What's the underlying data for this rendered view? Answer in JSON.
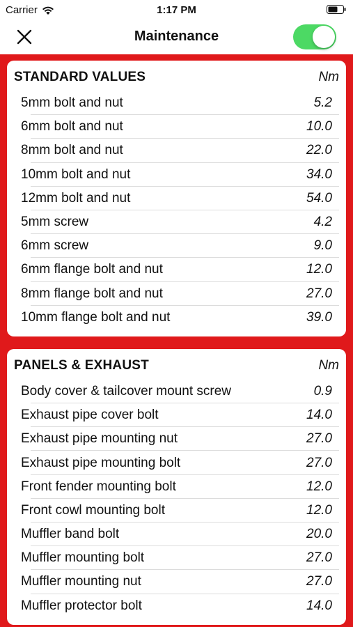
{
  "status_bar": {
    "carrier": "Carrier",
    "time": "1:17 PM"
  },
  "nav": {
    "title": "Maintenance",
    "toggle_on": true
  },
  "colors": {
    "background": "#e0191b",
    "toggle": "#4cd964"
  },
  "sections": [
    {
      "title": "STANDARD VALUES",
      "unit": "Nm",
      "rows": [
        {
          "label": "5mm bolt and nut",
          "value": "5.2"
        },
        {
          "label": "6mm bolt and nut",
          "value": "10.0"
        },
        {
          "label": "8mm bolt and nut",
          "value": "22.0"
        },
        {
          "label": "10mm bolt and nut",
          "value": "34.0"
        },
        {
          "label": "12mm bolt and nut",
          "value": "54.0"
        },
        {
          "label": "5mm screw",
          "value": "4.2"
        },
        {
          "label": "6mm screw",
          "value": "9.0"
        },
        {
          "label": "6mm flange bolt and nut",
          "value": "12.0"
        },
        {
          "label": "8mm flange bolt and nut",
          "value": "27.0"
        },
        {
          "label": "10mm flange bolt and nut",
          "value": "39.0"
        }
      ]
    },
    {
      "title": "PANELS & EXHAUST",
      "unit": "Nm",
      "rows": [
        {
          "label": "Body cover & tailcover mount screw",
          "value": "0.9"
        },
        {
          "label": "Exhaust pipe cover bolt",
          "value": "14.0"
        },
        {
          "label": "Exhaust pipe mounting nut",
          "value": "27.0"
        },
        {
          "label": "Exhaust pipe mounting bolt",
          "value": "27.0"
        },
        {
          "label": "Front fender mounting bolt",
          "value": "12.0"
        },
        {
          "label": "Front cowl mounting bolt",
          "value": "12.0"
        },
        {
          "label": "Muffler band bolt",
          "value": "20.0"
        },
        {
          "label": "Muffler mounting bolt",
          "value": "27.0"
        },
        {
          "label": "Muffler mounting nut",
          "value": "27.0"
        },
        {
          "label": "Muffler protector bolt",
          "value": "14.0"
        }
      ]
    }
  ]
}
